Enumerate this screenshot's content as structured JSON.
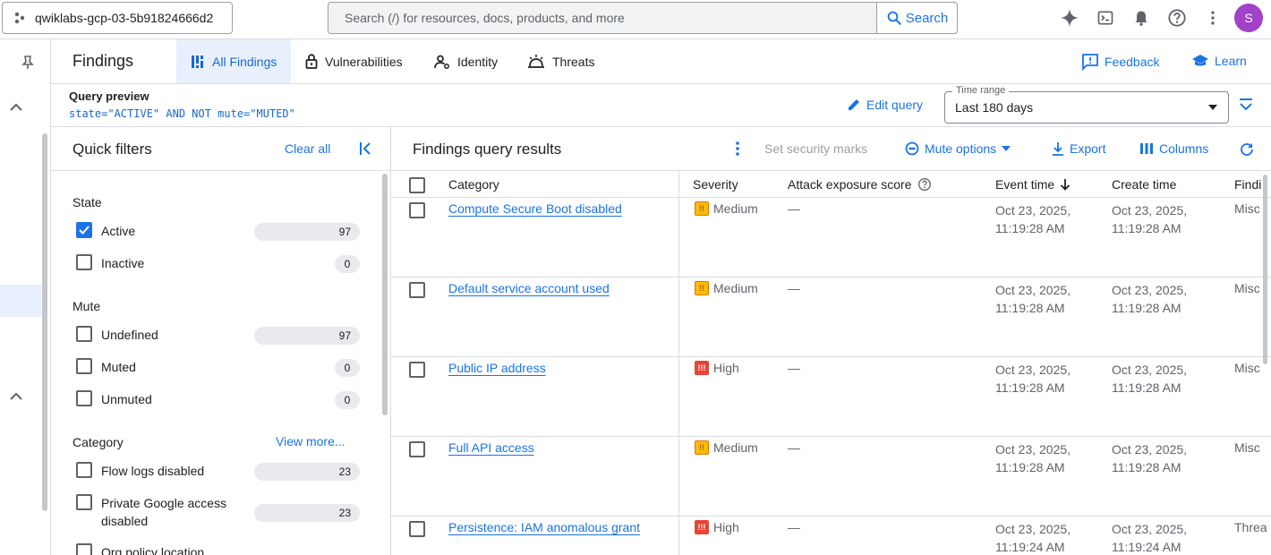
{
  "topbar": {
    "project": "qwiklabs-gcp-03-5b91824666d2",
    "search_placeholder": "Search (/) for resources, docs, products, and more",
    "search_button": "Search",
    "avatar_letter": "S"
  },
  "header": {
    "title": "Findings",
    "tabs": [
      {
        "label": "All Findings",
        "icon": "grid-icon",
        "active": true
      },
      {
        "label": "Vulnerabilities",
        "icon": "lock-icon"
      },
      {
        "label": "Identity",
        "icon": "identity-icon"
      },
      {
        "label": "Threats",
        "icon": "threats-icon"
      }
    ],
    "feedback": "Feedback",
    "learn": "Learn"
  },
  "query": {
    "label": "Query preview",
    "text": "state=\"ACTIVE\" AND NOT mute=\"MUTED\"",
    "edit": "Edit query",
    "time_range_label": "Time range",
    "time_range_value": "Last 180 days"
  },
  "quick_filters": {
    "title": "Quick filters",
    "clear_all": "Clear all",
    "sections": [
      {
        "title": "State",
        "items": [
          {
            "label": "Active",
            "count": "97",
            "checked": true
          },
          {
            "label": "Inactive",
            "count": "0",
            "checked": false
          }
        ]
      },
      {
        "title": "Mute",
        "items": [
          {
            "label": "Undefined",
            "count": "97",
            "checked": false
          },
          {
            "label": "Muted",
            "count": "0",
            "checked": false
          },
          {
            "label": "Unmuted",
            "count": "0",
            "checked": false
          }
        ]
      },
      {
        "title": "Category",
        "view_more": "View more...",
        "items": [
          {
            "label": "Flow logs disabled",
            "count": "23",
            "checked": false
          },
          {
            "label": "Private Google access disabled",
            "count": "23",
            "checked": false
          },
          {
            "label": "Org policy location",
            "count": "",
            "checked": false
          }
        ]
      }
    ]
  },
  "results": {
    "title": "Findings query results",
    "actions": {
      "set_marks": "Set security marks",
      "mute_options": "Mute options",
      "export": "Export",
      "columns": "Columns"
    },
    "columns": [
      "Category",
      "Severity",
      "Attack exposure score",
      "Event time",
      "Create time",
      "Findi"
    ],
    "rows": [
      {
        "category": "Compute Secure Boot disabled",
        "severity": "Medium",
        "aes": "—",
        "event_date": "Oct 23, 2025,",
        "event_time": "11:19:28 AM",
        "create_date": "Oct 23, 2025,",
        "create_time": "11:19:28 AM",
        "finding_class": "Misc"
      },
      {
        "category": "Default service account used",
        "severity": "Medium",
        "aes": "—",
        "event_date": "Oct 23, 2025,",
        "event_time": "11:19:28 AM",
        "create_date": "Oct 23, 2025,",
        "create_time": "11:19:28 AM",
        "finding_class": "Misc"
      },
      {
        "category": "Public IP address",
        "severity": "High",
        "aes": "—",
        "event_date": "Oct 23, 2025,",
        "event_time": "11:19:28 AM",
        "create_date": "Oct 23, 2025,",
        "create_time": "11:19:28 AM",
        "finding_class": "Misc"
      },
      {
        "category": "Full API access",
        "severity": "Medium",
        "aes": "—",
        "event_date": "Oct 23, 2025,",
        "event_time": "11:19:28 AM",
        "create_date": "Oct 23, 2025,",
        "create_time": "11:19:28 AM",
        "finding_class": "Misc"
      },
      {
        "category": "Persistence: IAM anomalous grant",
        "severity": "High",
        "aes": "—",
        "event_date": "Oct 23, 2025,",
        "event_time": "11:19:24 AM",
        "create_date": "Oct 23, 2025,",
        "create_time": "11:19:24 AM",
        "finding_class": "Threa"
      }
    ]
  },
  "colors": {
    "accent": "#1a73e8",
    "medium": "#fbbc04",
    "high": "#ea4335",
    "avatar": "#a142c9"
  }
}
